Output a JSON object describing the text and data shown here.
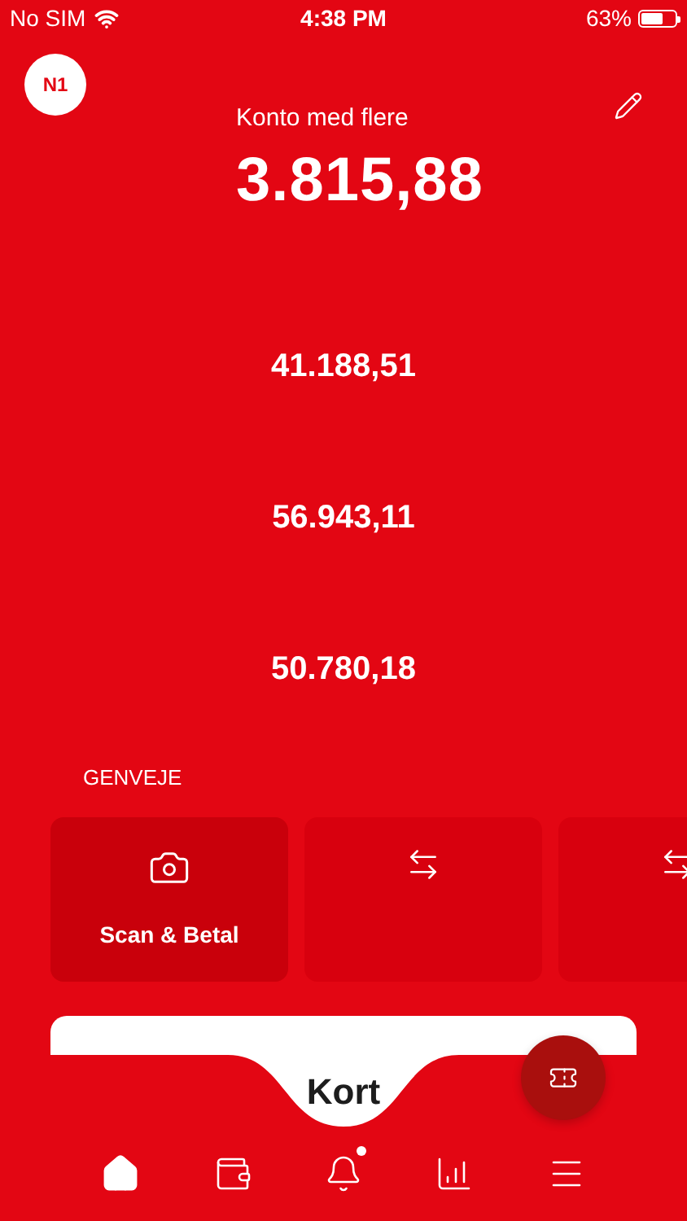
{
  "status_bar": {
    "carrier": "No SIM",
    "time": "4:38 PM",
    "battery": "63%"
  },
  "header": {
    "avatar": "N1",
    "title": "Konto med flere",
    "balance": "3.815,88"
  },
  "accounts": [
    {
      "amount": "41.188,51"
    },
    {
      "amount": "56.943,11"
    },
    {
      "amount": "50.780,18"
    }
  ],
  "shortcuts": {
    "heading": "GENVEJE",
    "items": [
      {
        "kind": "camera",
        "label": "Scan & Betal"
      },
      {
        "kind": "transfer"
      },
      {
        "kind": "transfer"
      }
    ]
  },
  "card_tab": {
    "label": "Kort"
  },
  "nav": [
    {
      "kind": "home",
      "selected": true,
      "badge": false
    },
    {
      "kind": "wallet",
      "selected": false,
      "badge": false
    },
    {
      "kind": "bell",
      "selected": false,
      "badge": true
    },
    {
      "kind": "chart",
      "selected": false,
      "badge": false
    },
    {
      "kind": "menu",
      "selected": false,
      "badge": false
    }
  ]
}
